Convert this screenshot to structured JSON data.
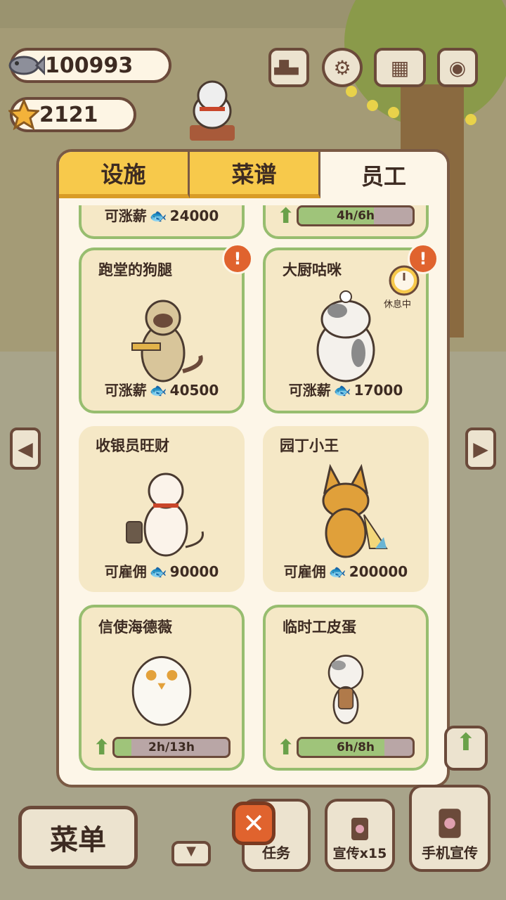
{
  "hud": {
    "fish_count": "100993",
    "star_count": "2121"
  },
  "top_icons": [
    "ranking-icon",
    "gear-icon",
    "book-icon",
    "camera-icon"
  ],
  "tabs": [
    {
      "label": "设施",
      "active": false
    },
    {
      "label": "菜谱",
      "active": false
    },
    {
      "label": "员工",
      "active": true
    }
  ],
  "staff": {
    "partial_left_price": "可涨薪",
    "partial_left_value": "24000",
    "partial_right_progress": "4h/6h",
    "cards": [
      {
        "name": "跑堂的狗腿",
        "price_label": "可涨薪",
        "price": "40500"
      },
      {
        "name": "大厨咕咪",
        "price_label": "可涨薪",
        "price": "17000",
        "status": "休息中"
      },
      {
        "name": "收银员旺财",
        "price_label": "可雇佣",
        "price": "90000"
      },
      {
        "name": "园丁小王",
        "price_label": "可雇佣",
        "price": "200000"
      },
      {
        "name": "信使海德薇",
        "progress": "2h/13h",
        "progress_value": 0.15
      },
      {
        "name": "临时工皮蛋",
        "progress": "6h/8h",
        "progress_value": 0.75
      }
    ]
  },
  "bottom": {
    "menu_label": "菜单",
    "task_label": "任务",
    "promote_label": "宣传x15",
    "phone_promote_label": "手机宣传"
  },
  "colors": {
    "accent": "#f7c94b",
    "panel": "#fdf6e8",
    "card": "#f5e8c6",
    "border": "#7a5a44",
    "green": "#97bd6f",
    "alert": "#e0632e"
  }
}
